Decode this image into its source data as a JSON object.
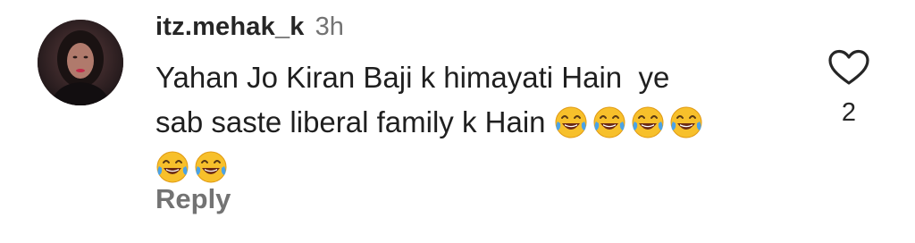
{
  "comment": {
    "username": "itz.mehak_k",
    "time": "3h",
    "text_line1": "Yahan Jo Kiran Baji k himayati Hain  ye",
    "text_line2": "sab saste liberal family k Hain ",
    "emoji_name": "face-with-tears-of-joy",
    "emoji_count_line2": 4,
    "emoji_count_line3": 2,
    "reply_label": "Reply",
    "like_count": "2"
  },
  "colors": {
    "username": "#262626",
    "muted": "#737373",
    "text": "#1f1f1f"
  },
  "icons": {
    "like": "heart-outline-icon",
    "emoji": "face-with-tears-of-joy"
  }
}
